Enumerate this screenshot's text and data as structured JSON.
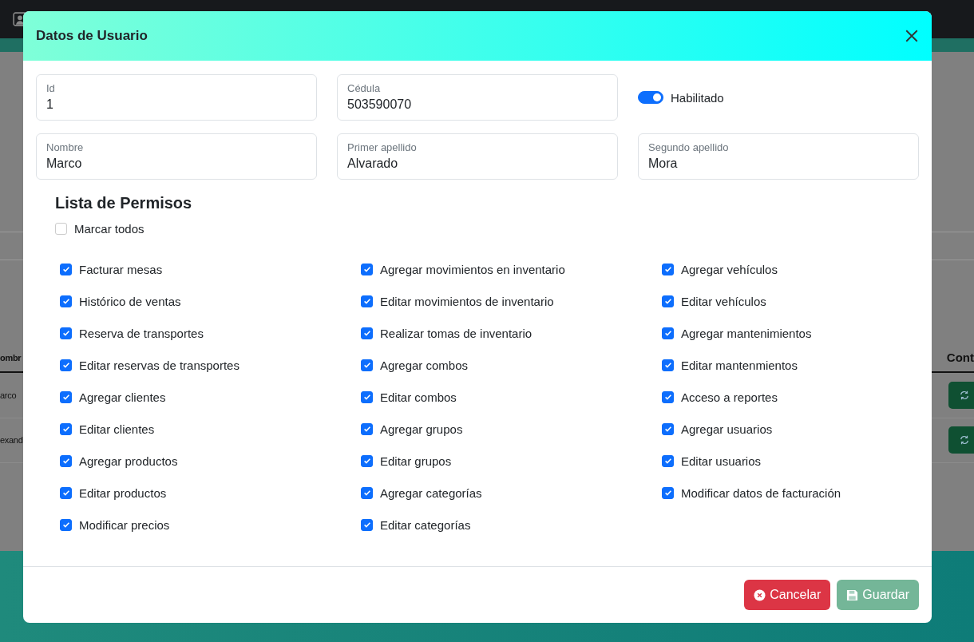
{
  "background": {
    "table_header": [
      "ombr",
      "Cont"
    ],
    "table_rows": [
      [
        "arco"
      ],
      [
        "exand"
      ]
    ]
  },
  "modal": {
    "title": "Datos de Usuario",
    "fields": [
      {
        "label": "Id",
        "value": "1"
      },
      {
        "label": "Cédula",
        "value": "503590070"
      },
      {
        "label": "Nombre",
        "value": "Marco"
      },
      {
        "label": "Primer apellido",
        "value": "Alvarado"
      },
      {
        "label": "Segundo apellido",
        "value": "Mora"
      }
    ],
    "enabled": {
      "label": "Habilitado",
      "on": true
    },
    "permissions": {
      "title": "Lista de Permisos",
      "select_all": {
        "label": "Marcar todos",
        "checked": false
      },
      "columns": [
        [
          {
            "label": "Facturar mesas",
            "checked": true
          },
          {
            "label": "Histórico de ventas",
            "checked": true
          },
          {
            "label": "Reserva de transportes",
            "checked": true
          },
          {
            "label": "Editar reservas de transportes",
            "checked": true
          },
          {
            "label": "Agregar clientes",
            "checked": true
          },
          {
            "label": "Editar clientes",
            "checked": true
          },
          {
            "label": "Agregar productos",
            "checked": true
          },
          {
            "label": "Editar productos",
            "checked": true
          },
          {
            "label": "Modificar precios",
            "checked": true
          }
        ],
        [
          {
            "label": "Agregar movimientos en inventario",
            "checked": true
          },
          {
            "label": "Editar movimientos de inventario",
            "checked": true
          },
          {
            "label": "Realizar tomas de inventario",
            "checked": true
          },
          {
            "label": "Agregar combos",
            "checked": true
          },
          {
            "label": "Editar combos",
            "checked": true
          },
          {
            "label": "Agregar grupos",
            "checked": true
          },
          {
            "label": "Editar grupos",
            "checked": true
          },
          {
            "label": "Agregar categorías",
            "checked": true
          },
          {
            "label": "Editar categorías",
            "checked": true
          }
        ],
        [
          {
            "label": "Agregar vehículos",
            "checked": true
          },
          {
            "label": "Editar vehículos",
            "checked": true
          },
          {
            "label": "Agregar mantenimientos",
            "checked": true
          },
          {
            "label": "Editar mantenmientos",
            "checked": true
          },
          {
            "label": "Acceso a reportes",
            "checked": true
          },
          {
            "label": "Agregar usuarios",
            "checked": true
          },
          {
            "label": "Editar usuarios",
            "checked": true
          },
          {
            "label": "Modificar datos de facturación",
            "checked": true
          }
        ]
      ]
    },
    "buttons": [
      {
        "label": "Cancelar",
        "kind": "cancel",
        "disabled": false
      },
      {
        "label": "Guardar",
        "kind": "save",
        "disabled": true
      }
    ]
  }
}
